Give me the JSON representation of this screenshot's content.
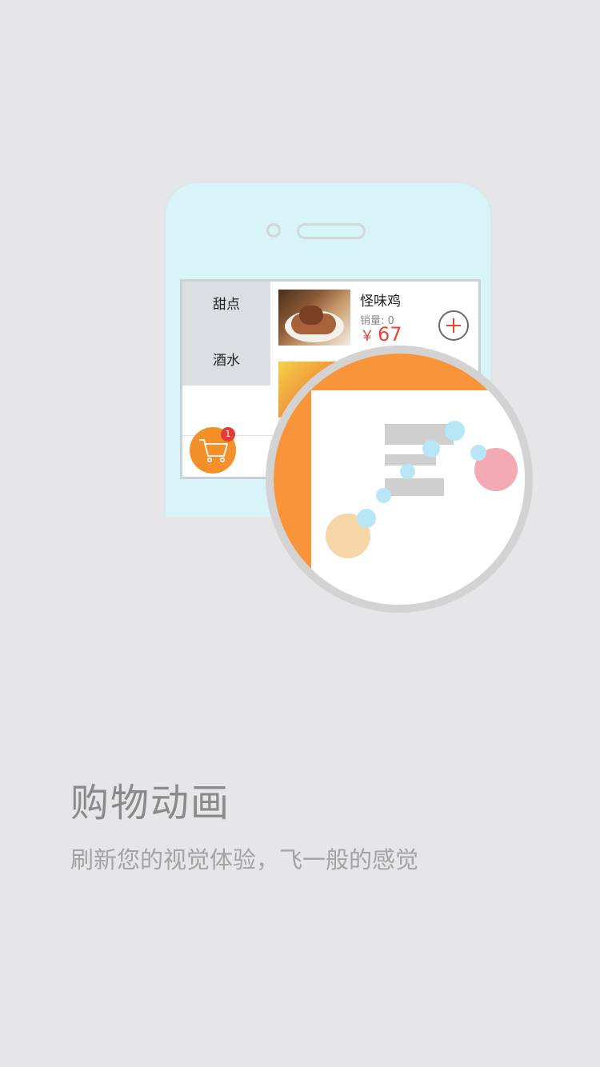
{
  "screen": {
    "title": "购物动画",
    "subtitle": "刷新您的视觉体验，飞一般的感觉"
  },
  "phone_mockup": {
    "categories": [
      "甜点",
      "酒水"
    ],
    "item": {
      "name": "怪味鸡",
      "sales": "销量: 0",
      "currency": "￥",
      "price": "67"
    },
    "cart_badge": "1"
  },
  "icons": {
    "add": "plus-circle-icon",
    "cart": "shopping-cart-icon"
  },
  "colors": {
    "background": "#e6e6e8",
    "accent_orange": "#f39029",
    "price_red": "#e8473a",
    "badge_red": "#e43b37",
    "phone_body": "#d8f4f8",
    "ball_pink": "#f4aab2",
    "ball_peach": "#f7d7a8",
    "trail_blue": "#b7e7f6"
  }
}
